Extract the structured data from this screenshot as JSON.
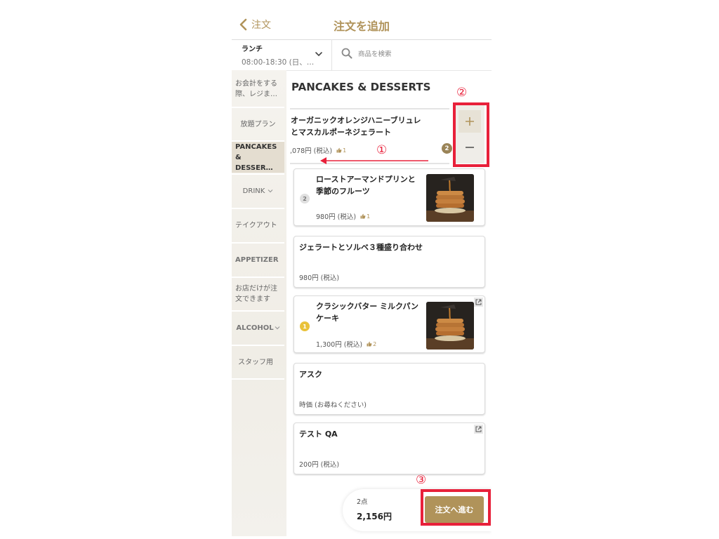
{
  "header": {
    "back_label": "注文",
    "title": "注文を追加"
  },
  "menu": {
    "name": "ランチ",
    "time": "08:00-18:30 (日、…"
  },
  "search": {
    "placeholder": "商品を検索"
  },
  "sidebar": {
    "items": [
      {
        "label": "お会計をする際、レジま…",
        "active": false
      },
      {
        "label": "放題プラン",
        "active": false
      },
      {
        "label": "PANCAKES & DESSER…",
        "active": true
      },
      {
        "label": "DRINK",
        "active": false,
        "expandable": true
      },
      {
        "label": "テイクアウト",
        "active": false
      },
      {
        "label": "APPETIZER",
        "active": false
      },
      {
        "label": "お店だけが注文できます",
        "active": false
      },
      {
        "label": "ALCOHOL",
        "active": false,
        "expandable": true
      },
      {
        "label": "スタッフ用",
        "active": false
      }
    ]
  },
  "section": {
    "title": "PANCAKES & DESSERTS"
  },
  "items": [
    {
      "name_line1": "オーガニックオレンジハニーブリュレ",
      "name_line2": "とマスカルポーネジェラート",
      "price": ",078円 (税込)",
      "likes": "1",
      "quantity": "2"
    },
    {
      "name_line1": "ローストアーマンドプリンと",
      "name_line2": "季節のフルーツ",
      "price": "980円 (税込)",
      "likes": "1",
      "rank": "2"
    },
    {
      "name_line1": "ジェラートとソルベ３種盛り合わせ",
      "price": "980円 (税込)"
    },
    {
      "name_line1": "クラシックバター ミルクパン",
      "name_line2": "ケーキ",
      "price": "1,300円 (税込)",
      "likes": "2",
      "rank": "1"
    },
    {
      "name_line1": "アスク",
      "price": "時価 (お尋ねください)"
    },
    {
      "name_line1": "テスト QA",
      "price": "200円 (税込)"
    }
  ],
  "cart": {
    "count": "2点",
    "total": "2,156円",
    "proceed_label": "注文へ進む"
  },
  "annotations": {
    "one": "①",
    "two": "②",
    "three": "③"
  },
  "colors": {
    "accent": "#b0935a",
    "annotation": "#e8203a"
  },
  "icons": {
    "back": "chevron-left-icon",
    "search": "search-icon",
    "like": "thumbs-up-icon",
    "external": "external-link-icon"
  }
}
